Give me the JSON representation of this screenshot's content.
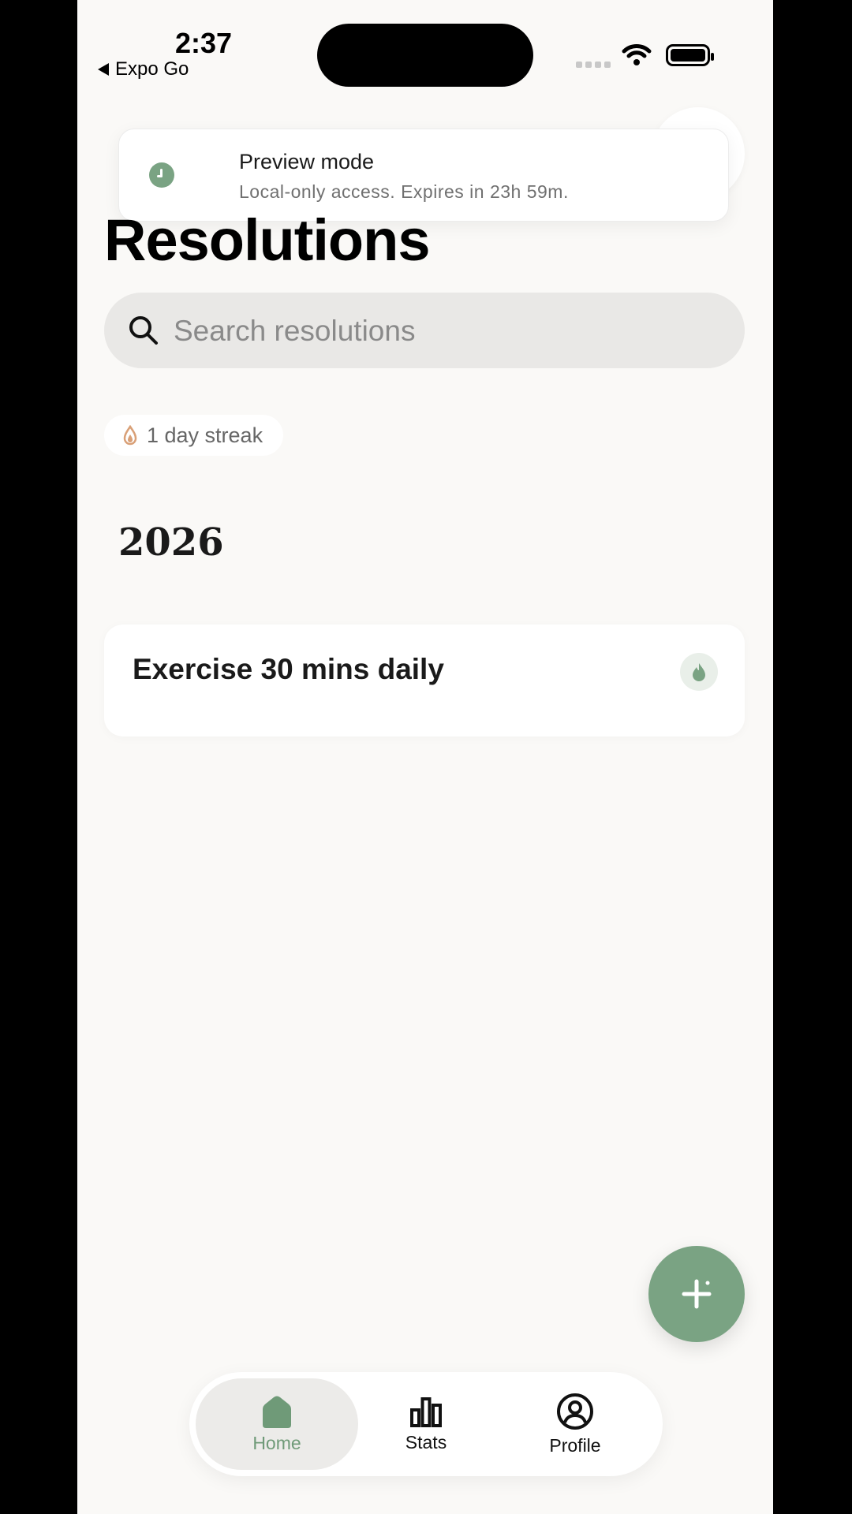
{
  "status_bar": {
    "time": "2:37",
    "back_label": "Expo Go"
  },
  "toast": {
    "title": "Preview mode",
    "subtitle": "Local-only access. Expires in 23h 59m."
  },
  "header": {
    "title": "Resolutions"
  },
  "search": {
    "placeholder": "Search resolutions",
    "value": ""
  },
  "streak": {
    "label": "1 day streak"
  },
  "section": {
    "year": "2026"
  },
  "resolutions": [
    {
      "title": "Exercise 30 mins daily"
    }
  ],
  "tabs": [
    {
      "label": "Home",
      "active": true
    },
    {
      "label": "Stats",
      "active": false
    },
    {
      "label": "Profile",
      "active": false
    }
  ],
  "colors": {
    "accent": "#7aa383",
    "background": "#faf9f7",
    "streak_icon": "#d9a077"
  },
  "icons": [
    "clock-icon",
    "search-icon",
    "flame-icon",
    "plus-icon",
    "home-icon",
    "stats-icon",
    "profile-icon"
  ]
}
